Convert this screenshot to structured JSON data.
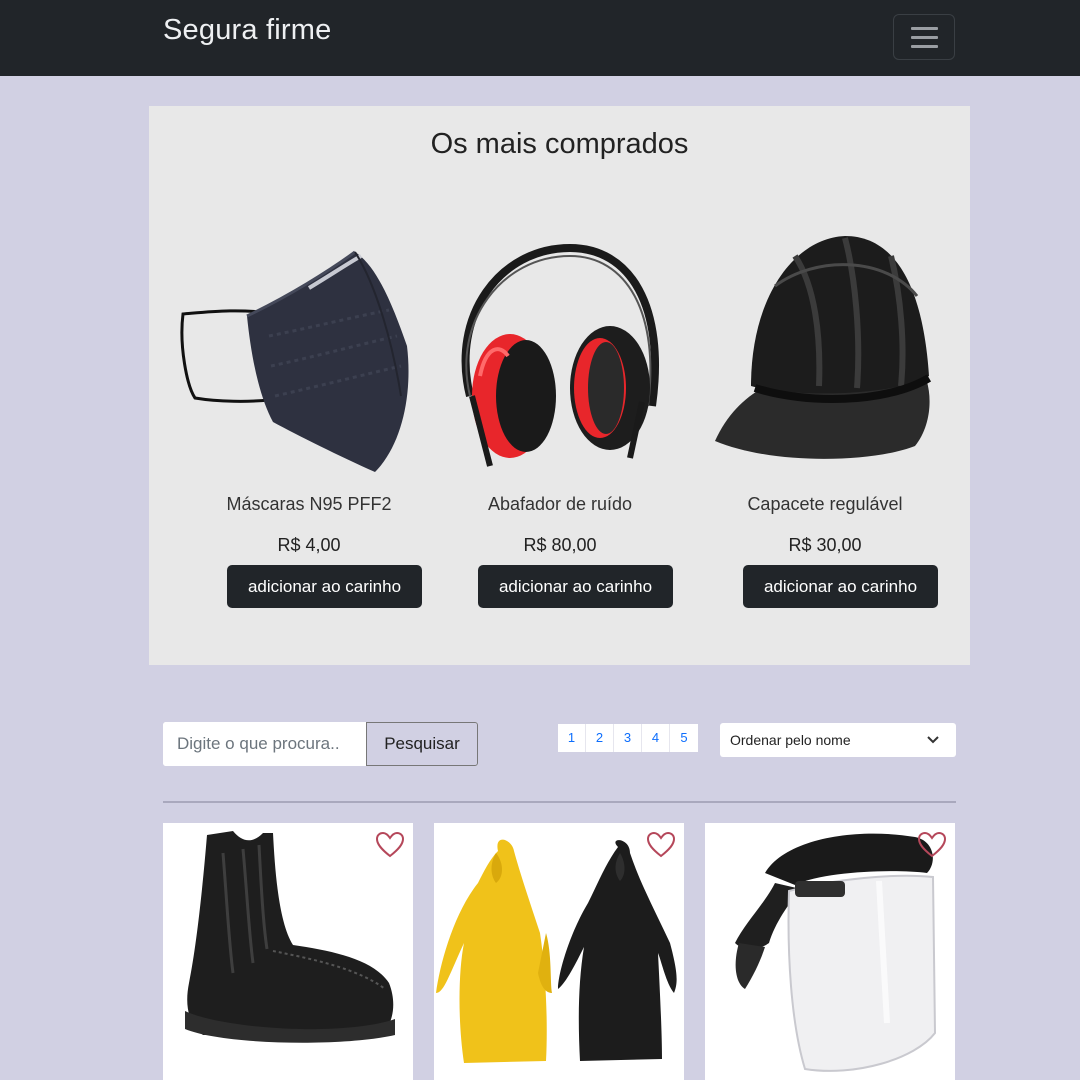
{
  "navbar": {
    "brand": "Segura firme",
    "toggler_icon": "hamburger-menu-icon"
  },
  "featured": {
    "title": "Os mais comprados",
    "products": [
      {
        "name": "Máscaras N95 PFF2",
        "price": "R$ 4,00",
        "button": "adicionar ao carinho",
        "image": "n95-mask-image"
      },
      {
        "name": "Abafador de ruído",
        "price": "R$ 80,00",
        "button": "adicionar ao carinho",
        "image": "earmuffs-image"
      },
      {
        "name": "Capacete regulável",
        "price": "R$ 30,00",
        "button": "adicionar ao carinho",
        "image": "hard-hat-image"
      }
    ]
  },
  "search": {
    "placeholder": "Digite o que procura..",
    "button": "Pesquisar"
  },
  "pagination": [
    "1",
    "2",
    "3",
    "4",
    "5"
  ],
  "sort": {
    "selected": "Ordenar pelo nome"
  },
  "catalog": [
    {
      "image": "safety-boot-image",
      "favorite_icon": "heart-icon"
    },
    {
      "image": "raincoats-image",
      "favorite_icon": "heart-icon"
    },
    {
      "image": "face-shield-image",
      "favorite_icon": "heart-icon"
    }
  ],
  "colors": {
    "navbar": "#212529",
    "page_bg": "#d1d0e3",
    "featured_bg": "#e8e8e8",
    "button_bg": "#212529",
    "heart": "#b5475a"
  }
}
